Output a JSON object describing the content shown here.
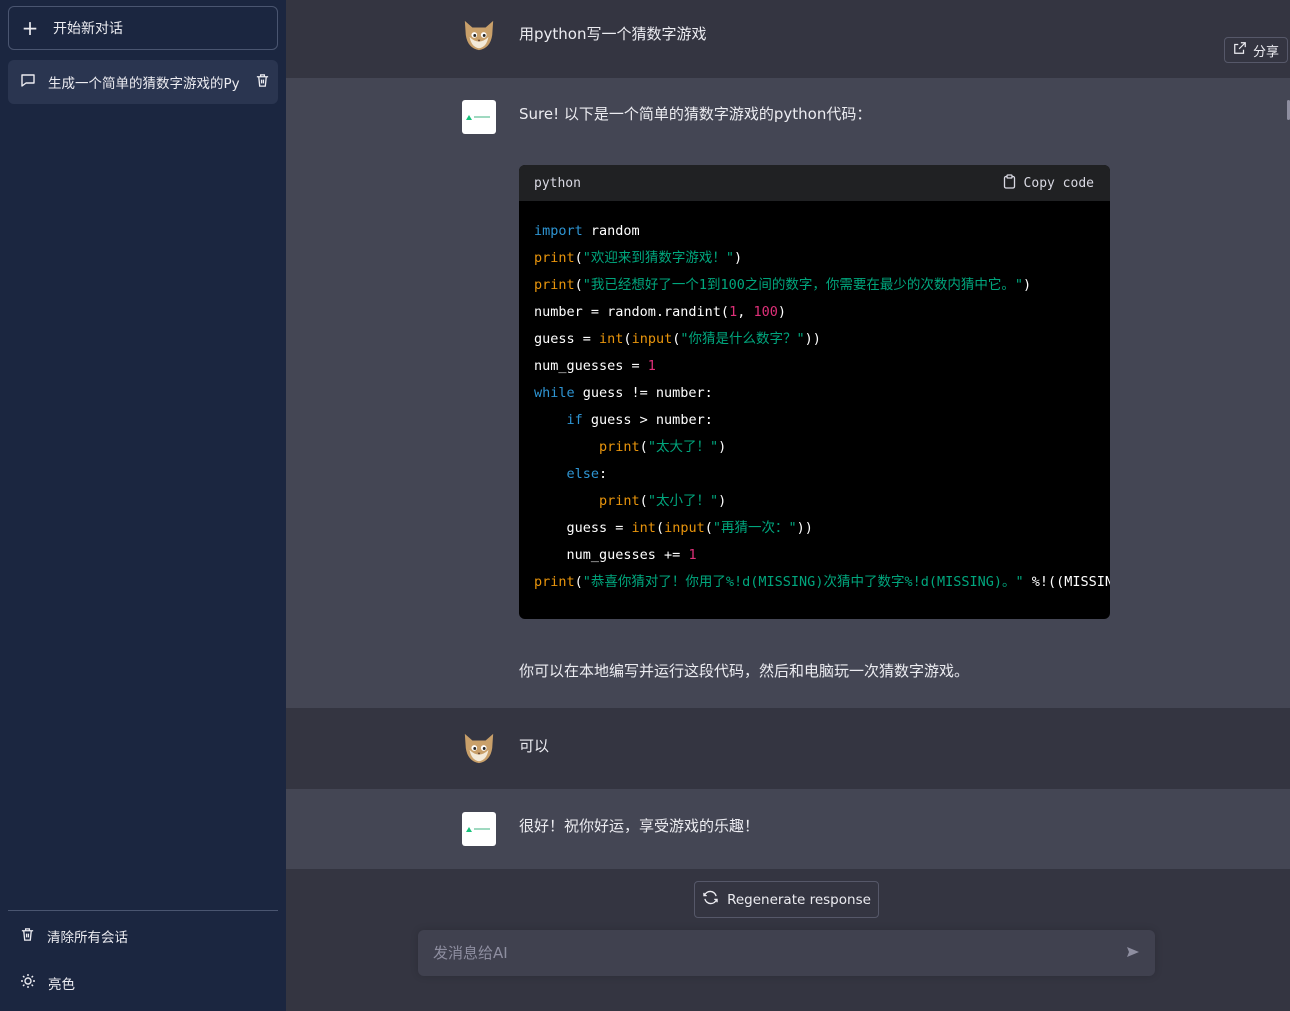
{
  "sidebar": {
    "new_chat_label": "开始新对话",
    "conversations": [
      {
        "label": "生成一个简单的猜数字游戏的Py"
      }
    ],
    "clear_all_label": "清除所有会话",
    "theme_label": "亮色"
  },
  "header": {
    "share_label": "分享"
  },
  "messages": [
    {
      "role": "user",
      "text": "用python写一个猜数字游戏"
    },
    {
      "role": "assistant",
      "text": "Sure! 以下是一个简单的猜数字游戏的python代码："
    },
    {
      "role": "assistant",
      "text": "你可以在本地编写并运行这段代码，然后和电脑玩一次猜数字游戏。"
    },
    {
      "role": "user",
      "text": "可以"
    },
    {
      "role": "assistant",
      "text": "很好！祝你好运，享受游戏的乐趣！"
    }
  ],
  "code_block": {
    "language": "python",
    "copy_label": "Copy code",
    "lines": [
      [
        [
          "kw",
          "import"
        ],
        [
          "plain",
          " random"
        ]
      ],
      [
        [
          "fn",
          "print"
        ],
        [
          "plain",
          "("
        ],
        [
          "str",
          "\"欢迎来到猜数字游戏！\""
        ],
        [
          "plain",
          ")"
        ]
      ],
      [
        [
          "fn",
          "print"
        ],
        [
          "plain",
          "("
        ],
        [
          "str",
          "\"我已经想好了一个1到100之间的数字，你需要在最少的次数内猜中它。\""
        ],
        [
          "plain",
          ")"
        ]
      ],
      [
        [
          "plain",
          "number = random.randint("
        ],
        [
          "num",
          "1"
        ],
        [
          "plain",
          ", "
        ],
        [
          "num",
          "100"
        ],
        [
          "plain",
          ")"
        ]
      ],
      [
        [
          "plain",
          "guess = "
        ],
        [
          "fn",
          "int"
        ],
        [
          "plain",
          "("
        ],
        [
          "fn",
          "input"
        ],
        [
          "plain",
          "("
        ],
        [
          "str",
          "\"你猜是什么数字？\""
        ],
        [
          "plain",
          "))"
        ]
      ],
      [
        [
          "plain",
          "num_guesses = "
        ],
        [
          "num",
          "1"
        ]
      ],
      [
        [
          "kw",
          "while"
        ],
        [
          "plain",
          " guess != number:"
        ]
      ],
      [
        [
          "plain",
          "    "
        ],
        [
          "kw",
          "if"
        ],
        [
          "plain",
          " guess > number:"
        ]
      ],
      [
        [
          "plain",
          "        "
        ],
        [
          "fn",
          "print"
        ],
        [
          "plain",
          "("
        ],
        [
          "str",
          "\"太大了！\""
        ],
        [
          "plain",
          ")"
        ]
      ],
      [
        [
          "plain",
          "    "
        ],
        [
          "kw",
          "else"
        ],
        [
          "plain",
          ":"
        ]
      ],
      [
        [
          "plain",
          "        "
        ],
        [
          "fn",
          "print"
        ],
        [
          "plain",
          "("
        ],
        [
          "str",
          "\"太小了！\""
        ],
        [
          "plain",
          ")"
        ]
      ],
      [
        [
          "plain",
          "    guess = "
        ],
        [
          "fn",
          "int"
        ],
        [
          "plain",
          "("
        ],
        [
          "fn",
          "input"
        ],
        [
          "plain",
          "("
        ],
        [
          "str",
          "\"再猜一次：\""
        ],
        [
          "plain",
          "))"
        ]
      ],
      [
        [
          "plain",
          "    num_guesses += "
        ],
        [
          "num",
          "1"
        ]
      ],
      [
        [
          "fn",
          "print"
        ],
        [
          "plain",
          "("
        ],
        [
          "str",
          "\"恭喜你猜对了！你用了%!d(MISSING)次猜中了数字%!d(MISSING)。\""
        ],
        [
          "plain",
          " %!((MISSIN"
        ]
      ]
    ]
  },
  "footer": {
    "regenerate_label": "Regenerate response",
    "input_placeholder": "发消息给AI",
    "input_value": ""
  },
  "colors": {
    "sidebar_bg": "#1b2640",
    "main_bg": "#343541",
    "bot_row_bg": "#444654",
    "code_bg": "#000000",
    "keyword": "#2e95d3",
    "function": "#e9950c",
    "string": "#00a67d",
    "number": "#df3079"
  },
  "icons": {
    "user_avatar": "cat-face-icon",
    "assistant_avatar": "brand-logo-icon"
  }
}
